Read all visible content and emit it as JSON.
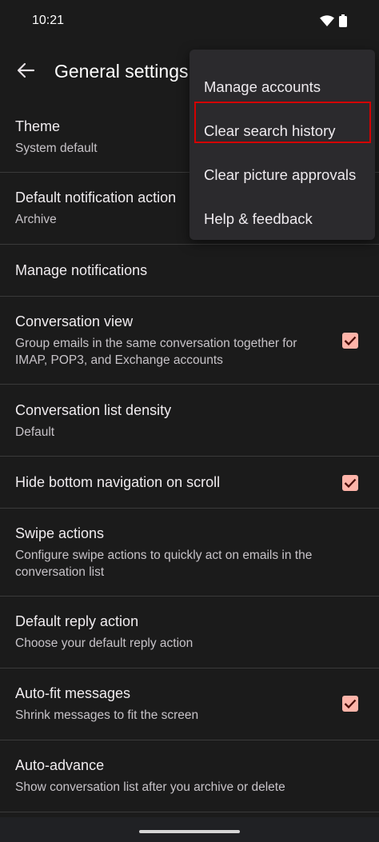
{
  "status_bar": {
    "time": "10:21"
  },
  "header": {
    "title": "General settings"
  },
  "settings": [
    {
      "title": "Theme",
      "subtitle": "System default"
    },
    {
      "title": "Default notification action",
      "subtitle": "Archive"
    },
    {
      "title": "Manage notifications",
      "subtitle": ""
    },
    {
      "title": "Conversation view",
      "subtitle": "Group emails in the same conversation together for IMAP, POP3, and Exchange accounts",
      "checked": true
    },
    {
      "title": "Conversation list density",
      "subtitle": "Default"
    },
    {
      "title": "Hide bottom navigation on scroll",
      "subtitle": "",
      "checked": true
    },
    {
      "title": "Swipe actions",
      "subtitle": "Configure swipe actions to quickly act on emails in the conversation list"
    },
    {
      "title": "Default reply action",
      "subtitle": "Choose your default reply action"
    },
    {
      "title": "Auto-fit messages",
      "subtitle": "Shrink messages to fit the screen",
      "checked": true
    },
    {
      "title": "Auto-advance",
      "subtitle": "Show conversation list after you archive or delete"
    }
  ],
  "menu": {
    "items": [
      {
        "label": "Manage accounts"
      },
      {
        "label": "Clear search history"
      },
      {
        "label": "Clear picture approvals"
      },
      {
        "label": "Help & feedback"
      }
    ],
    "highlighted_item": "Clear search history"
  },
  "colors": {
    "background": "#1b1b1b",
    "checkbox": "#ffb4a9",
    "menu_background": "#2b2a2d",
    "highlight_border": "#d40000"
  }
}
